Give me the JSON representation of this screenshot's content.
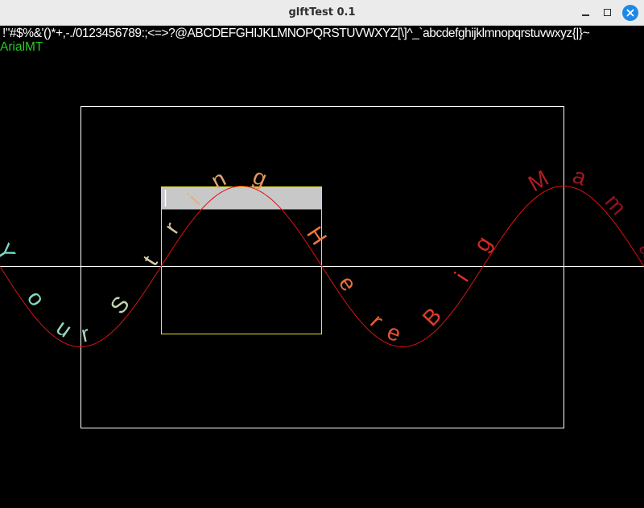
{
  "window": {
    "title": "glftTest 0.1",
    "icons": {
      "minimize": "minimize-icon",
      "maximize": "maximize-icon",
      "close": "close-icon"
    }
  },
  "canvas": {
    "glyph_line": "!\"#$%&'()*+,-./0123456789:;<=>?@ABCDEFGHIJKLMNOPQRSTUVWXYZ[\\]^_`abcdefghijklmnopqrstuvwxyz{|}~",
    "font_name": "ArialMT",
    "curve_text": "Your String Here Big Mama",
    "colors": {
      "background": "#000000",
      "font_name": "#22cc22",
      "frame": "#ffffff",
      "text_box_border": "#e6e632",
      "text_box_header": "#c8c8c8",
      "curve": "#dd1111"
    }
  }
}
